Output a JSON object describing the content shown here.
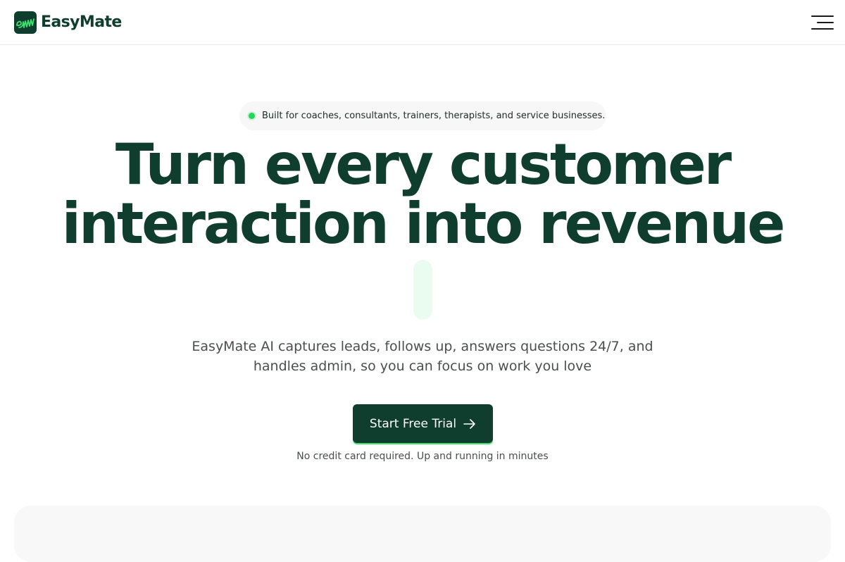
{
  "header": {
    "brand_name": "EasyMate",
    "logo_icon": "em-logo-icon",
    "menu_icon": "hamburger-menu-icon"
  },
  "hero": {
    "badge_text": "Built for coaches, consultants, trainers, therapists, and service businesses.",
    "headline_line1": "Turn every customer",
    "headline_line2": "interaction into revenue",
    "subtext_line1": "EasyMate AI captures leads, follows up, answers questions 24/7, and",
    "subtext_line2": "handles admin, so you can focus on work you love",
    "cta_label": "Start Free Trial",
    "cta_icon": "arrow-right-icon",
    "note": "No credit card required. Up and running in minutes"
  },
  "colors": {
    "brand_dark_green": "#0f3d2e",
    "accent_green": "#22d65a",
    "text_gray": "#4a4f4c"
  }
}
